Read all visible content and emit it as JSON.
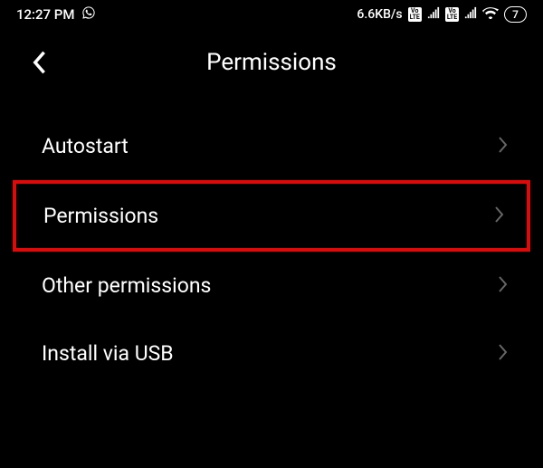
{
  "status_bar": {
    "time": "12:27 PM",
    "data_speed": "6.6KB/s",
    "battery_level": "7",
    "volte_label": "Vo\nLTE"
  },
  "header": {
    "title": "Permissions"
  },
  "list": {
    "items": [
      {
        "label": "Autostart"
      },
      {
        "label": "Permissions"
      },
      {
        "label": "Other permissions"
      },
      {
        "label": "Install via USB"
      }
    ]
  }
}
